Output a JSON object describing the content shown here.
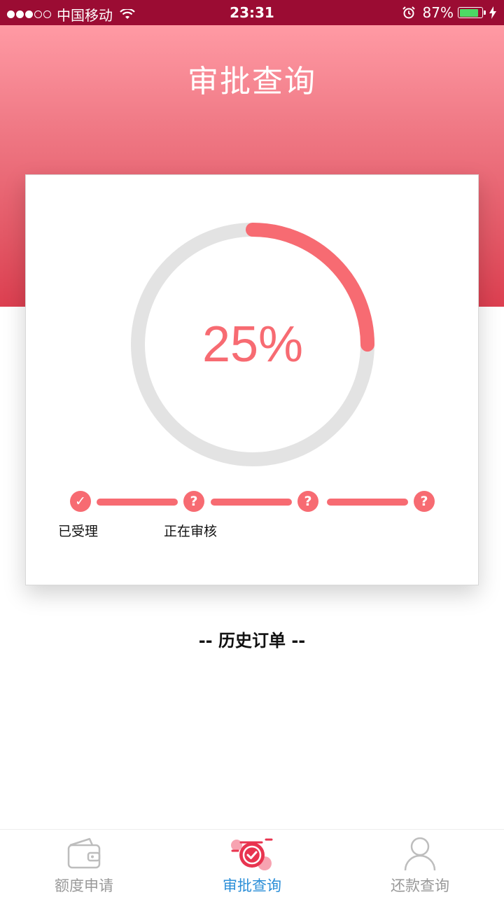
{
  "status_bar": {
    "carrier": "中国移动",
    "time": "23:31",
    "battery": "87%",
    "battery_level": 0.87
  },
  "header": {
    "title": "审批查询"
  },
  "progress": {
    "percent_label": "25%",
    "value": 0.25,
    "accent_color": "#f76b72",
    "track_color": "#e3e3e3"
  },
  "steps": [
    {
      "icon": "check-icon",
      "glyph": "✓",
      "label": "已受理"
    },
    {
      "icon": "question-icon",
      "glyph": "?",
      "label": "正在审核"
    },
    {
      "icon": "question-icon",
      "glyph": "?",
      "label": ""
    },
    {
      "icon": "question-icon",
      "glyph": "?",
      "label": ""
    }
  ],
  "history": {
    "title": "-- 历史订单 --"
  },
  "tabs": [
    {
      "label": "额度申请",
      "icon": "wallet-icon",
      "active": false
    },
    {
      "label": "审批查询",
      "icon": "approval-check-icon",
      "active": true
    },
    {
      "label": "还款查询",
      "icon": "user-icon",
      "active": false
    }
  ],
  "colors": {
    "status_bar": "#9b0c33",
    "active_tab": "#2c8fd8",
    "inactive_tab": "#999999"
  }
}
